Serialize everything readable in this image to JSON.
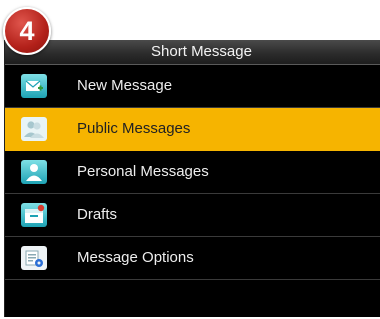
{
  "step_badge": "4",
  "header": {
    "title": "Short Message"
  },
  "menu": {
    "items": [
      {
        "label": "New Message",
        "icon": "new-message-icon",
        "selected": false
      },
      {
        "label": "Public Messages",
        "icon": "public-messages-icon",
        "selected": true
      },
      {
        "label": "Personal Messages",
        "icon": "personal-messages-icon",
        "selected": false
      },
      {
        "label": "Drafts",
        "icon": "drafts-icon",
        "selected": false
      },
      {
        "label": "Message Options",
        "icon": "message-options-icon",
        "selected": false
      }
    ]
  },
  "colors": {
    "selection": "#f6b400",
    "background": "#000000",
    "badge": "#c0271e"
  }
}
